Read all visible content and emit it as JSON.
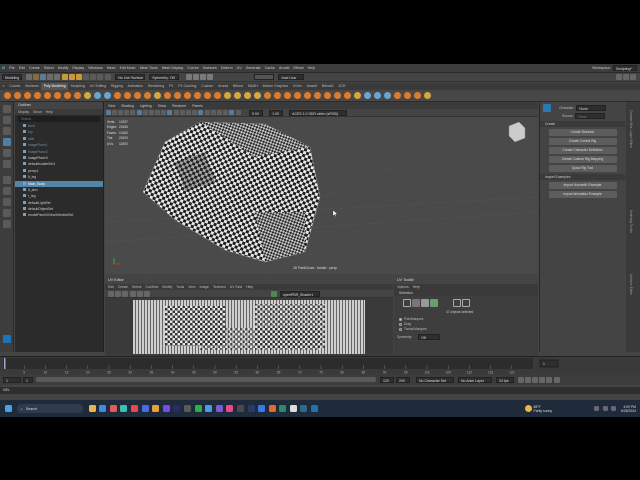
{
  "menubar": {
    "workspace_label": "Workspace:",
    "workspace_value": "Sculpting*",
    "items": [
      "File",
      "Edit",
      "Create",
      "Select",
      "Modify",
      "Display",
      "Windows",
      "Mesh",
      "Edit Mesh",
      "Mesh Tools",
      "Mesh Display",
      "Curves",
      "Surfaces",
      "Deform",
      "UV",
      "Generate",
      "Cache",
      "Arnold",
      "Bifrost",
      "Help"
    ]
  },
  "status_line": {
    "mode": "Modeling",
    "no_live": "No Live Surface",
    "symmetry": "Symmetry: Off",
    "user": "Jose Lisa"
  },
  "shelf_tabs": [
    "Curves",
    "Surfaces",
    "Poly Modeling",
    "Sculpting",
    "UV Editing",
    "Rigging",
    "Animation",
    "Rendering",
    "FX",
    "FX Caching",
    "Custom",
    "Arnold",
    "Bifrost",
    "MASH",
    "Motion Graphics",
    "XGen",
    "Aswelt",
    "Bifrost2",
    "ZCR"
  ],
  "shelf_active": "Poly Modeling",
  "outliner": {
    "title": "Outliner",
    "menu": [
      "Display",
      "Show",
      "Help"
    ],
    "search": "Search...",
    "items": [
      {
        "label": "front",
        "style": "dim"
      },
      {
        "label": "top",
        "style": "dim"
      },
      {
        "label": "side",
        "style": "dim"
      },
      {
        "label": "imagePlane1",
        "style": "dim"
      },
      {
        "label": "imagePlane2",
        "style": "dim"
      },
      {
        "label": "imagePlane3",
        "style": ""
      },
      {
        "label": "defaultIsolateSet1",
        "style": ""
      },
      {
        "label": "persp1",
        "style": ""
      },
      {
        "label": "lt_leg",
        "style": ""
      },
      {
        "label": "Main_Body",
        "style": "sel"
      },
      {
        "label": "lt_arm",
        "style": ""
      },
      {
        "label": "r_leg",
        "style": ""
      },
      {
        "label": "defaultLightSet",
        "style": ""
      },
      {
        "label": "defaultObjectSet",
        "style": ""
      },
      {
        "label": "modelPanel4ViewSelectedSet",
        "style": ""
      }
    ]
  },
  "viewport": {
    "menu": [
      "View",
      "Shading",
      "Lighting",
      "Show",
      "Renderer",
      "Panels"
    ],
    "hud_labels": [
      "Verts:",
      "Edges:",
      "Faces:",
      "Tris:",
      "UVs:"
    ],
    "hud_values": [
      "10297",
      "20456",
      "10160",
      "20320",
      "11800"
    ],
    "field1": "0.00",
    "field2": "1.00",
    "colorspace": "ACES 1.0 SDR-video (sRGB)",
    "camera_label": "3D Paint/Zoom : Isolate : persp"
  },
  "uv_editor": {
    "title": "UV Editor",
    "menu": [
      "Edit",
      "Create",
      "Select",
      "Cut/Sew",
      "Modify",
      "Tools",
      "View",
      "Image",
      "Textures",
      "UV Sets",
      "Help"
    ],
    "shader": "openPBR_Shader1"
  },
  "uv_toolkit": {
    "title": "UV Toolkit",
    "menu": [
      "Options",
      "Help"
    ],
    "section": "Selection",
    "count": "47 objects selected",
    "options": [
      "Pick/Marquee",
      "Drag",
      "Tweak/Marquee"
    ],
    "symmetry_label": "Symmetry:",
    "symmetry_value": "Off"
  },
  "humanik": {
    "character_label": "Character:",
    "character_value": "None",
    "source_label": "Source:",
    "source_value": "None",
    "section_create": "Create",
    "buttons_create": [
      "Create Skeleton",
      "Create Control Rig",
      "Create Character Definition",
      "Create Custom Rig Mapping",
      "Quick Rig Tool"
    ],
    "section_import": "Import Examples",
    "buttons_import": [
      "Import HumanIK Example",
      "Import Animation Example"
    ]
  },
  "attr_strip": [
    "Channel Box / Layer Editor",
    "Modeling Toolkit",
    "Attribute Editor"
  ],
  "timeline": {
    "ticks": [
      "5",
      "10",
      "15",
      "20",
      "25",
      "30",
      "35",
      "40",
      "45",
      "50",
      "55",
      "60",
      "65",
      "70",
      "75",
      "80",
      "85",
      "90",
      "95",
      "100",
      "105",
      "110",
      "115",
      "120"
    ],
    "current": "1"
  },
  "range": {
    "start": "1",
    "start2": "1",
    "end": "120",
    "end2": "200",
    "char_set": "No Character Set",
    "anim_layer": "No Anim Layer",
    "fps": "24 fps"
  },
  "cmd_label": "MEL",
  "taskbar": {
    "search": "Search",
    "weather_temp": "88°F",
    "weather_desc": "Partly sunny",
    "time": "4:09 PM",
    "date": "6/28/2024"
  },
  "colors": {
    "accent": "#5285a6",
    "shelf_orange": "#e07b2c",
    "viewport_bg": "#4a4a4a"
  }
}
